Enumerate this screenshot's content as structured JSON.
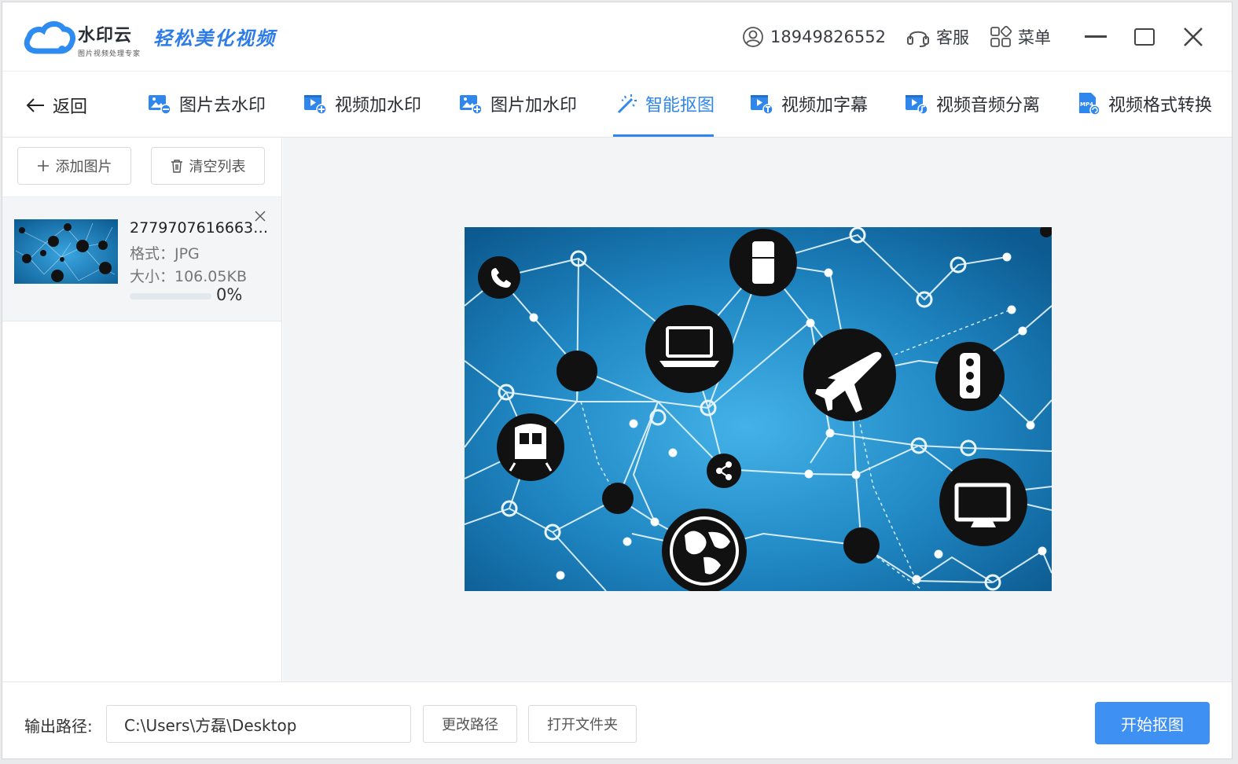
{
  "app": {
    "name": "水印云",
    "sub": "图片视频处理专家",
    "slogan": "轻松美化视频"
  },
  "titlebar": {
    "phone": "18949826552",
    "service": "客服",
    "menu": "菜单"
  },
  "nav": {
    "back": "返回",
    "tabs": [
      {
        "label": "图片去水印",
        "icon": "image-remove-icon"
      },
      {
        "label": "视频加水印",
        "icon": "video-add-icon"
      },
      {
        "label": "图片加水印",
        "icon": "image-add-icon"
      },
      {
        "label": "智能抠图",
        "icon": "magic-wand-icon",
        "active": true
      },
      {
        "label": "视频加字幕",
        "icon": "video-text-icon"
      },
      {
        "label": "视频音频分离",
        "icon": "video-audio-icon"
      },
      {
        "label": "视频格式转换",
        "icon": "mp4-icon"
      }
    ]
  },
  "sidebar": {
    "add_label": "添加图片",
    "clear_label": "清空列表",
    "files": [
      {
        "name": "27797076166634...",
        "format": "格式：JPG",
        "size": "大小：106.05KB",
        "progress": "0%",
        "progress_value": 0
      }
    ]
  },
  "bottom": {
    "output_label": "输出路径:",
    "output_path": "C:\\Users\\方磊\\Desktop",
    "change_label": "更改路径",
    "open_label": "打开文件夹",
    "start_label": "开始抠图"
  },
  "colors": {
    "accent": "#2f86ec",
    "start_button": "#3e91f3",
    "preview_bg": "#1f7fb8"
  }
}
